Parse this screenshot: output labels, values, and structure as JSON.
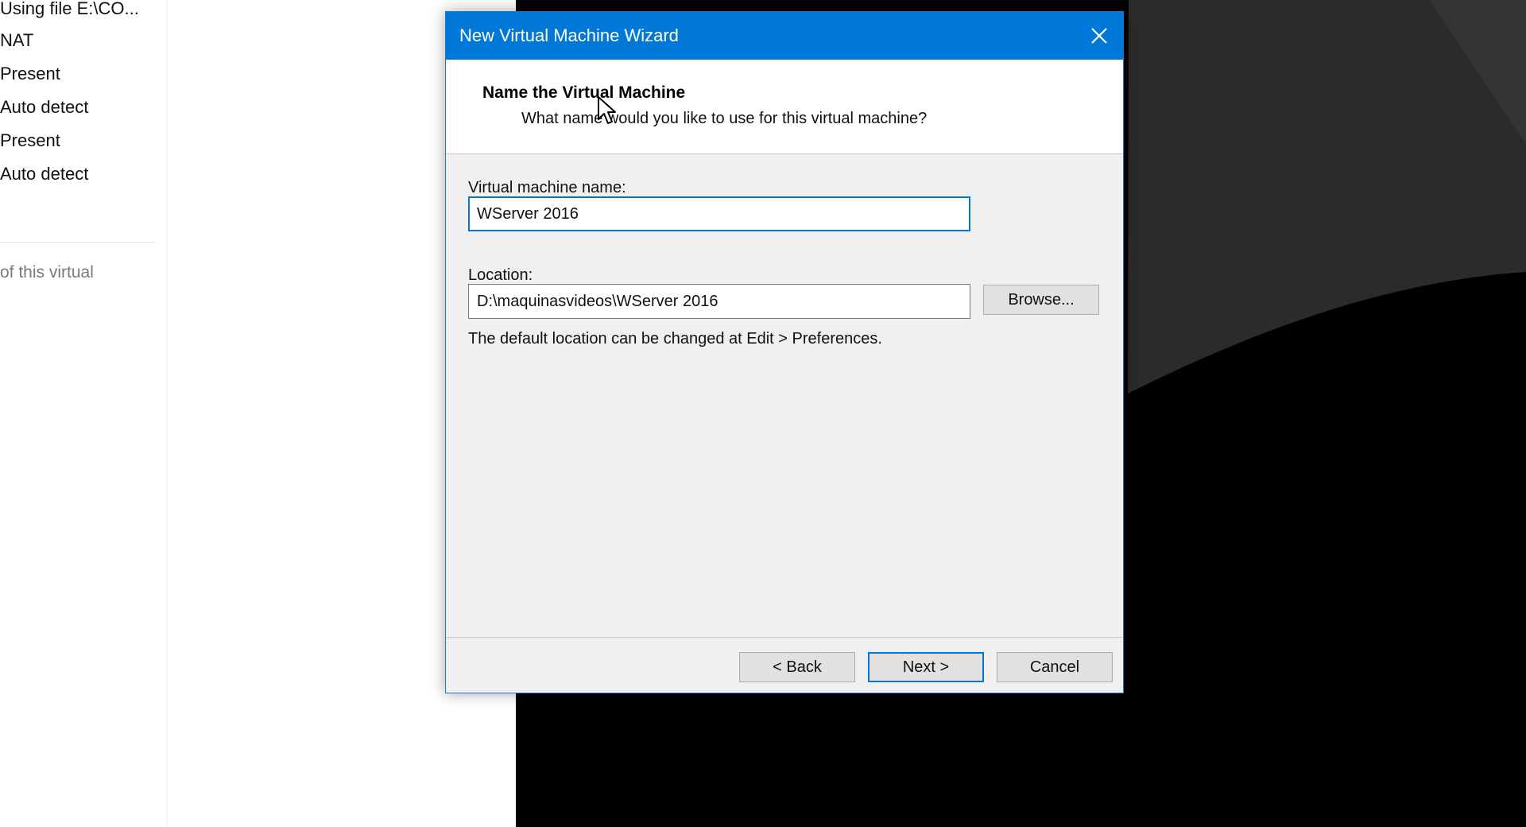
{
  "background": {
    "hardware_values": [
      "Using file E:\\CO...",
      "NAT",
      "Present",
      "Auto detect",
      "Present",
      "Auto detect"
    ],
    "description_snippet": "of this virtual"
  },
  "dialog": {
    "title": "New Virtual Machine Wizard",
    "close_icon": "close-icon",
    "header": {
      "title": "Name the Virtual Machine",
      "subtitle": "What name would you like to use for this virtual machine?"
    },
    "vm_name": {
      "label": "Virtual machine name:",
      "value": "WServer 2016"
    },
    "location": {
      "label": "Location:",
      "value": "D:\\maquinasvideos\\WServer 2016",
      "browse_label": "Browse..."
    },
    "hint": "The default location can be changed at Edit > Preferences.",
    "buttons": {
      "back": "< Back",
      "next": "Next >",
      "cancel": "Cancel"
    }
  },
  "colors": {
    "title_bar": "#0078d7",
    "dialog_bg": "#f0f0f0",
    "focus_border": "#0078d7",
    "console_bg": "#000000"
  }
}
